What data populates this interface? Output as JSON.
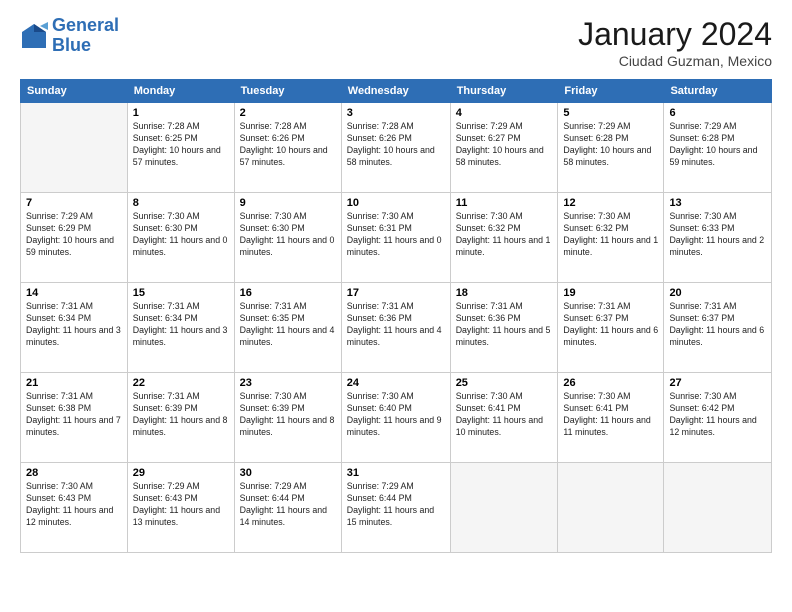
{
  "header": {
    "logo_line1": "General",
    "logo_line2": "Blue",
    "month": "January 2024",
    "location": "Ciudad Guzman, Mexico"
  },
  "weekdays": [
    "Sunday",
    "Monday",
    "Tuesday",
    "Wednesday",
    "Thursday",
    "Friday",
    "Saturday"
  ],
  "weeks": [
    [
      {
        "day": "",
        "empty": true
      },
      {
        "day": "1",
        "sunrise": "7:28 AM",
        "sunset": "6:25 PM",
        "daylight": "10 hours and 57 minutes."
      },
      {
        "day": "2",
        "sunrise": "7:28 AM",
        "sunset": "6:26 PM",
        "daylight": "10 hours and 57 minutes."
      },
      {
        "day": "3",
        "sunrise": "7:28 AM",
        "sunset": "6:26 PM",
        "daylight": "10 hours and 58 minutes."
      },
      {
        "day": "4",
        "sunrise": "7:29 AM",
        "sunset": "6:27 PM",
        "daylight": "10 hours and 58 minutes."
      },
      {
        "day": "5",
        "sunrise": "7:29 AM",
        "sunset": "6:28 PM",
        "daylight": "10 hours and 58 minutes."
      },
      {
        "day": "6",
        "sunrise": "7:29 AM",
        "sunset": "6:28 PM",
        "daylight": "10 hours and 59 minutes."
      }
    ],
    [
      {
        "day": "7",
        "sunrise": "7:29 AM",
        "sunset": "6:29 PM",
        "daylight": "10 hours and 59 minutes."
      },
      {
        "day": "8",
        "sunrise": "7:30 AM",
        "sunset": "6:30 PM",
        "daylight": "11 hours and 0 minutes."
      },
      {
        "day": "9",
        "sunrise": "7:30 AM",
        "sunset": "6:30 PM",
        "daylight": "11 hours and 0 minutes."
      },
      {
        "day": "10",
        "sunrise": "7:30 AM",
        "sunset": "6:31 PM",
        "daylight": "11 hours and 0 minutes."
      },
      {
        "day": "11",
        "sunrise": "7:30 AM",
        "sunset": "6:32 PM",
        "daylight": "11 hours and 1 minute."
      },
      {
        "day": "12",
        "sunrise": "7:30 AM",
        "sunset": "6:32 PM",
        "daylight": "11 hours and 1 minute."
      },
      {
        "day": "13",
        "sunrise": "7:30 AM",
        "sunset": "6:33 PM",
        "daylight": "11 hours and 2 minutes."
      }
    ],
    [
      {
        "day": "14",
        "sunrise": "7:31 AM",
        "sunset": "6:34 PM",
        "daylight": "11 hours and 3 minutes."
      },
      {
        "day": "15",
        "sunrise": "7:31 AM",
        "sunset": "6:34 PM",
        "daylight": "11 hours and 3 minutes."
      },
      {
        "day": "16",
        "sunrise": "7:31 AM",
        "sunset": "6:35 PM",
        "daylight": "11 hours and 4 minutes."
      },
      {
        "day": "17",
        "sunrise": "7:31 AM",
        "sunset": "6:36 PM",
        "daylight": "11 hours and 4 minutes."
      },
      {
        "day": "18",
        "sunrise": "7:31 AM",
        "sunset": "6:36 PM",
        "daylight": "11 hours and 5 minutes."
      },
      {
        "day": "19",
        "sunrise": "7:31 AM",
        "sunset": "6:37 PM",
        "daylight": "11 hours and 6 minutes."
      },
      {
        "day": "20",
        "sunrise": "7:31 AM",
        "sunset": "6:37 PM",
        "daylight": "11 hours and 6 minutes."
      }
    ],
    [
      {
        "day": "21",
        "sunrise": "7:31 AM",
        "sunset": "6:38 PM",
        "daylight": "11 hours and 7 minutes."
      },
      {
        "day": "22",
        "sunrise": "7:31 AM",
        "sunset": "6:39 PM",
        "daylight": "11 hours and 8 minutes."
      },
      {
        "day": "23",
        "sunrise": "7:30 AM",
        "sunset": "6:39 PM",
        "daylight": "11 hours and 8 minutes."
      },
      {
        "day": "24",
        "sunrise": "7:30 AM",
        "sunset": "6:40 PM",
        "daylight": "11 hours and 9 minutes."
      },
      {
        "day": "25",
        "sunrise": "7:30 AM",
        "sunset": "6:41 PM",
        "daylight": "11 hours and 10 minutes."
      },
      {
        "day": "26",
        "sunrise": "7:30 AM",
        "sunset": "6:41 PM",
        "daylight": "11 hours and 11 minutes."
      },
      {
        "day": "27",
        "sunrise": "7:30 AM",
        "sunset": "6:42 PM",
        "daylight": "11 hours and 12 minutes."
      }
    ],
    [
      {
        "day": "28",
        "sunrise": "7:30 AM",
        "sunset": "6:43 PM",
        "daylight": "11 hours and 12 minutes."
      },
      {
        "day": "29",
        "sunrise": "7:29 AM",
        "sunset": "6:43 PM",
        "daylight": "11 hours and 13 minutes."
      },
      {
        "day": "30",
        "sunrise": "7:29 AM",
        "sunset": "6:44 PM",
        "daylight": "11 hours and 14 minutes."
      },
      {
        "day": "31",
        "sunrise": "7:29 AM",
        "sunset": "6:44 PM",
        "daylight": "11 hours and 15 minutes."
      },
      {
        "day": "",
        "empty": true
      },
      {
        "day": "",
        "empty": true
      },
      {
        "day": "",
        "empty": true
      }
    ]
  ]
}
